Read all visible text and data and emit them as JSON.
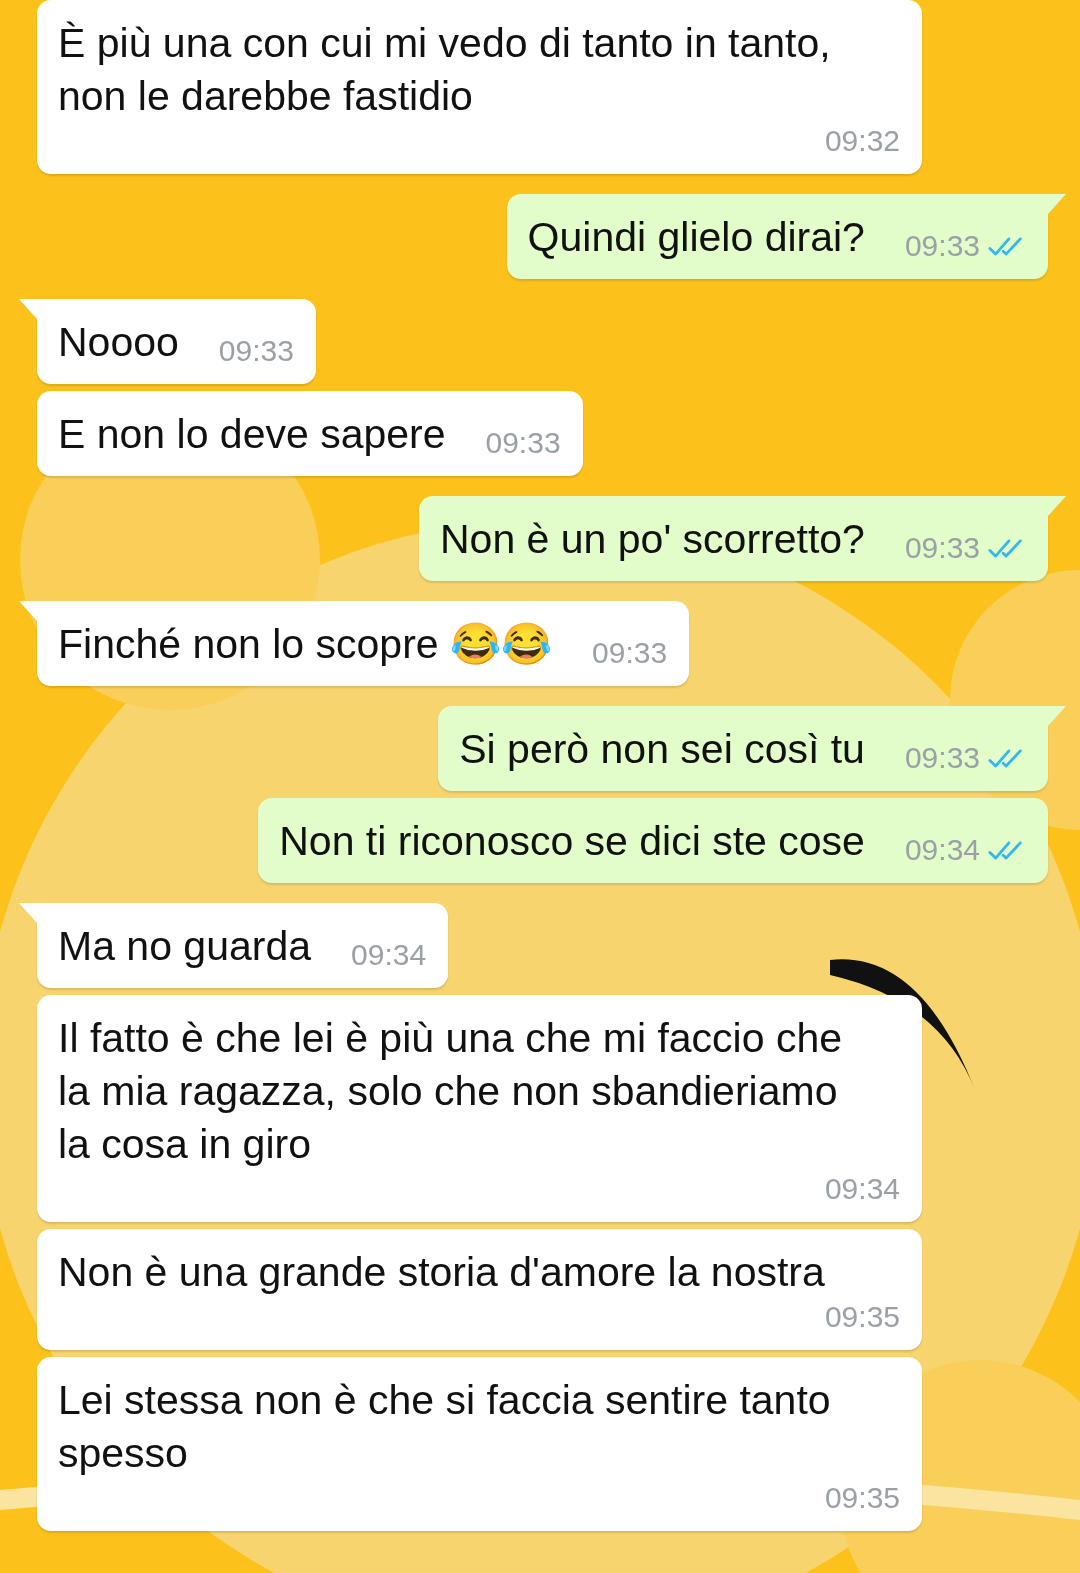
{
  "messages": [
    {
      "kind": "in",
      "tail": false,
      "text": "È più una con cui mi vedo di tanto in tanto, non le darebbe fastidio",
      "time": "09:32"
    },
    {
      "kind": "out",
      "tail": true,
      "read": true,
      "text": "Quindi glielo dirai?",
      "time": "09:33"
    },
    {
      "kind": "in",
      "tail": true,
      "text": "Noooo",
      "time": "09:33"
    },
    {
      "kind": "in",
      "tail": false,
      "text": "E non lo deve sapere",
      "time": "09:33"
    },
    {
      "kind": "out",
      "tail": true,
      "read": true,
      "text": "Non è un po' scorretto?",
      "time": "09:33"
    },
    {
      "kind": "in",
      "tail": true,
      "text": "Finché non lo scopre 😂😂",
      "time": "09:33"
    },
    {
      "kind": "out",
      "tail": true,
      "read": true,
      "text": "Si però non sei così tu",
      "time": "09:33"
    },
    {
      "kind": "out",
      "tail": false,
      "read": true,
      "text": "Non ti riconosco se dici ste cose",
      "time": "09:34"
    },
    {
      "kind": "in",
      "tail": true,
      "text": "Ma no guarda",
      "time": "09:34"
    },
    {
      "kind": "in",
      "tail": false,
      "text": "Il fatto è che lei è più una che mi faccio che la mia ragazza, solo che non sbandieriamo la cosa in giro",
      "time": "09:34"
    },
    {
      "kind": "in",
      "tail": false,
      "text": "Non è una grande storia d'amore la nostra",
      "time": "09:35"
    },
    {
      "kind": "in",
      "tail": false,
      "text": "Lei stessa non è che si faccia sentire tanto spesso",
      "time": "09:35"
    }
  ]
}
